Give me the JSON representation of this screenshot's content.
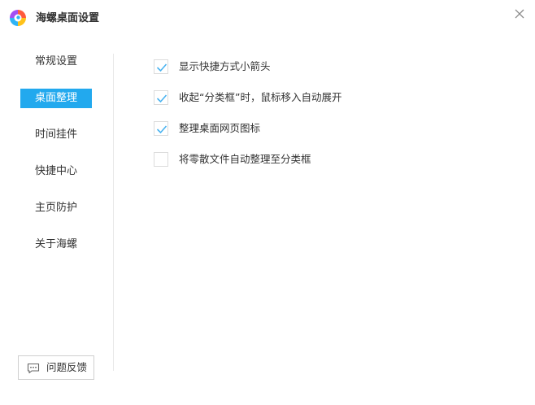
{
  "window": {
    "title": "海螺桌面设置",
    "logo_icon": "conch-logo-icon",
    "close_icon": "close-icon"
  },
  "sidebar": {
    "items": [
      {
        "label": "常规设置",
        "active": false
      },
      {
        "label": "桌面整理",
        "active": true
      },
      {
        "label": "时间挂件",
        "active": false
      },
      {
        "label": "快捷中心",
        "active": false
      },
      {
        "label": "主页防护",
        "active": false
      },
      {
        "label": "关于海螺",
        "active": false
      }
    ],
    "feedback": {
      "label": "问题反馈",
      "icon": "chat-bubble-icon"
    }
  },
  "options": [
    {
      "label": "显示快捷方式小箭头",
      "checked": true
    },
    {
      "label": "收起“分类框”时，鼠标移入自动展开",
      "checked": true
    },
    {
      "label": "整理桌面网页图标",
      "checked": true
    },
    {
      "label": "将零散文件自动整理至分类框",
      "checked": false
    }
  ],
  "colors": {
    "accent": "#22a9ee",
    "checkmark": "#4ab3f0",
    "text": "#333333",
    "divider": "#e8e8e8"
  }
}
